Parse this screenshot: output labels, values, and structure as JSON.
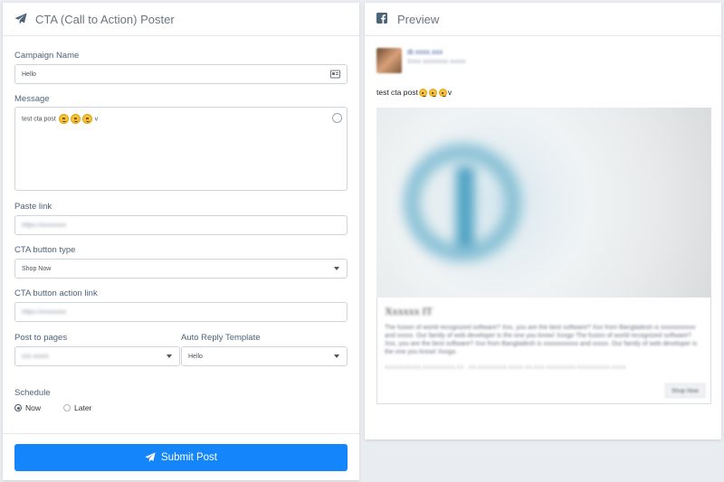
{
  "poster": {
    "header_title": "CTA (Call to Action) Poster",
    "campaign_name": {
      "label": "Campaign Name",
      "value": "Hello"
    },
    "message": {
      "label": "Message",
      "value": "test cta post",
      "suffix": "v"
    },
    "paste_link": {
      "label": "Paste link",
      "value": "https://xxxxxxxx"
    },
    "cta_type": {
      "label": "CTA button type",
      "value": "Shop Now"
    },
    "cta_action_link": {
      "label": "CTA button action link",
      "value": "https://xxxxxxxx"
    },
    "post_to_pages": {
      "label": "Post to pages",
      "value": "xxx xxxxx"
    },
    "auto_reply": {
      "label": "Auto Reply Template",
      "value": "Hello"
    },
    "schedule": {
      "label": "Schedule",
      "options": [
        {
          "label": "Now",
          "selected": true
        },
        {
          "label": "Later",
          "selected": false
        }
      ]
    },
    "submit_label": "Submit Post"
  },
  "preview": {
    "header_title": "Preview",
    "page_name": "dr.xxxx.xxx",
    "page_sub": "Xxxx xxxxxxxx xxxxx",
    "message": "test cta post",
    "message_suffix": "v",
    "card": {
      "title": "Xxxxxx IT",
      "description": "The fusion of world recognized software? Xxx, you are the best software? Xxx from Bangladesh is xxxxxxxxxxx and xxxxx. Our family of web developer is the one you know! Xxxgo The fusion of world recognized software? Xxx, you are the best software? Xxx from Bangladesh is xxxxxxxxxxx and xxxxx. Our family of web developer is the one you know! Xxxgo.",
      "url": "XXXXXXXXXX.XXXXXXXXX.XX - XX-XXXXXXXX-XXXX-XX-XXX-XXXXXXXX-XXXXXXXXX-XXXX",
      "button": "Shop Now"
    }
  },
  "colors": {
    "primary": "#1485fa",
    "page_bg": "#e9ecf0",
    "fb_blue": "#3b5998"
  }
}
